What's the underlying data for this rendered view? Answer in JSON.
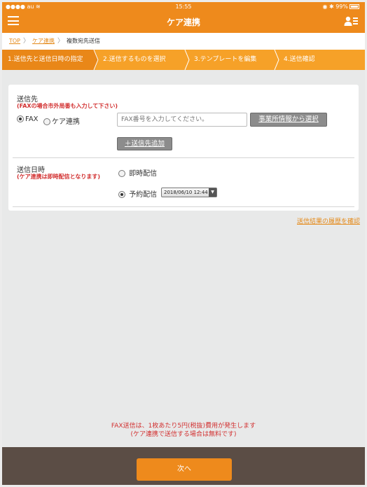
{
  "status_bar": {
    "carrier": "au",
    "time": "15:55",
    "battery": "99%"
  },
  "header": {
    "title": "ケア連携",
    "menu_icon": "menu-icon",
    "profile_icon": "user-card-icon"
  },
  "breadcrumb": {
    "items": [
      "TOP",
      "ケア連携"
    ],
    "current": "複数宛先送信"
  },
  "steps": [
    {
      "label": "1.送信先と送信日時の指定",
      "active": true
    },
    {
      "label": "2.送信するものを選択",
      "active": false
    },
    {
      "label": "3.テンプレートを編集",
      "active": false
    },
    {
      "label": "4.送信確認",
      "active": false
    }
  ],
  "destination": {
    "label": "送信先",
    "note": "(FAXの場合市外局番も入力して下さい)",
    "options": [
      {
        "label": "FAX",
        "selected": true
      },
      {
        "label": "ケア連携",
        "selected": false
      }
    ],
    "fax_input": {
      "value": "",
      "placeholder": "FAX番号を入力してください。"
    },
    "select_button": "事業所情報から選択",
    "add_button": "＋送信先追加"
  },
  "send_time": {
    "label": "送信日時",
    "note": "(ケア連携は即時配信となります)",
    "options": [
      {
        "label": "即時配信",
        "selected": false
      },
      {
        "label": "予約配信",
        "selected": true
      }
    ],
    "scheduled_value": "2018/06/10 12:44"
  },
  "history_link": "送信結果の履歴を確認",
  "fax_notice": {
    "line1": "FAX送信は、1枚あたり5円(税抜)費用が発生します",
    "line2": "(ケア連携で送信する場合は無料です)"
  },
  "footer": {
    "next_button": "次へ"
  },
  "colors": {
    "primary": "#ee8a1c",
    "step_bar": "#f6a128",
    "footer": "#5b4d45",
    "warning_text": "#d23030"
  }
}
